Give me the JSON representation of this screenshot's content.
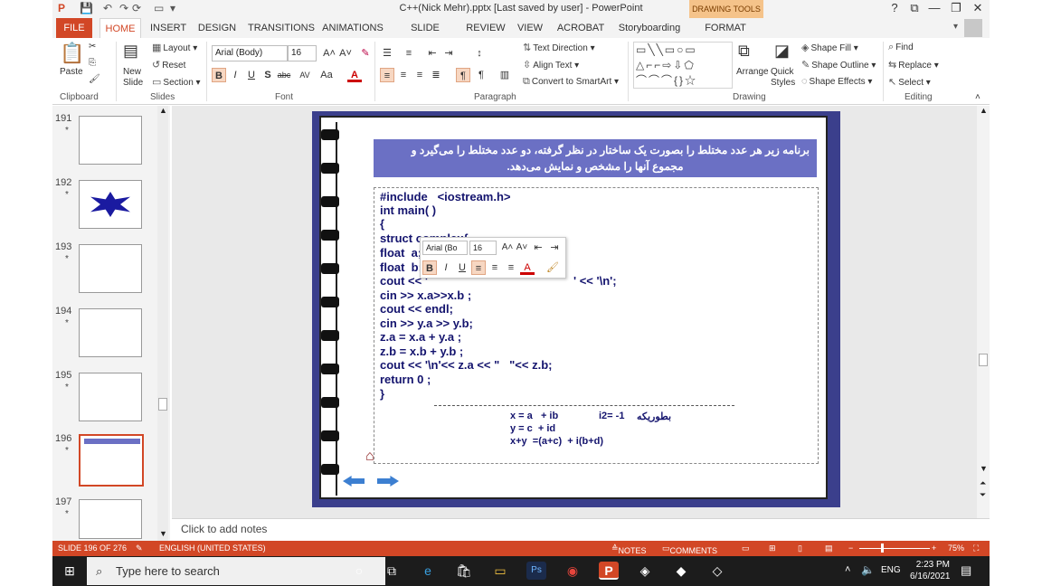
{
  "window": {
    "title": "C++(Nick Mehr).pptx [Last saved by user] - PowerPoint",
    "contextual_label": "DRAWING TOOLS",
    "help": "?",
    "restore": "⧉",
    "minimize": "—",
    "maximize": "❐",
    "close": "✕"
  },
  "qat": {
    "save": "💾",
    "undo": "↶",
    "redo": "↷",
    "refresh": "⟳",
    "customize": "▾"
  },
  "tabs": [
    "FILE",
    "HOME",
    "INSERT",
    "DESIGN",
    "TRANSITIONS",
    "ANIMATIONS",
    "SLIDE SHOW",
    "REVIEW",
    "VIEW",
    "ACROBAT",
    "Storyboarding",
    "FORMAT"
  ],
  "ribbon": {
    "clipboard": {
      "paste": "Paste",
      "label": "Clipboard"
    },
    "slides": {
      "new_slide": "New Slide",
      "layout": "Layout",
      "reset": "Reset",
      "section": "Section",
      "label": "Slides"
    },
    "font": {
      "name": "Arial (Body)",
      "size": "16",
      "label": "Font",
      "bold": "B",
      "italic": "I",
      "underline": "U",
      "shadow": "S",
      "strike": "abc",
      "spacing": "AV",
      "case": "Aa",
      "color": "A"
    },
    "paragraph": {
      "text_direction": "Text Direction",
      "align_text": "Align Text",
      "convert": "Convert to SmartArt",
      "label": "Paragraph"
    },
    "drawing": {
      "arrange": "Arrange",
      "quick_styles": "Quick Styles",
      "shape_fill": "Shape Fill",
      "shape_outline": "Shape Outline",
      "shape_effects": "Shape Effects",
      "label": "Drawing"
    },
    "editing": {
      "find": "Find",
      "replace": "Replace",
      "select": "Select",
      "label": "Editing"
    }
  },
  "thumbnails": [
    {
      "num": "191",
      "star": "*"
    },
    {
      "num": "192",
      "star": "*"
    },
    {
      "num": "193",
      "star": "*"
    },
    {
      "num": "194",
      "star": "*"
    },
    {
      "num": "195",
      "star": "*"
    },
    {
      "num": "196",
      "star": "*",
      "selected": true
    },
    {
      "num": "197",
      "star": "*"
    }
  ],
  "slide": {
    "banner_line1": "برنامه زیر هر عدد مختلط را بصورت یک ساختار در نظر گرفته، دو عدد مختلط را می‌گیرد و",
    "banner_line2": "مجموع آنها را مشخص و نمایش می‌دهد.",
    "code": [
      "#include   <iostream.h>",
      "int main( )",
      "{",
      "struct complex{",
      "float  a;",
      "float  b; }",
      "cout << '",
      "cin >> x.a>>x.b ;",
      "cout << endl;",
      "cin >> y.a >> y.b;",
      "z.a = x.a + y.a ;",
      "z.b = x.b + y.b ;",
      "cout << '\\n'<< z.a << \"   \"<< z.b;",
      "return 0 ;",
      "}"
    ],
    "code_tail": "' << '\\n';",
    "equations": {
      "eq1": "x = a   + ib",
      "eq1b": "i2= -1",
      "eq1c": "بطوریکه",
      "eq2": "y = c  + id",
      "eq3": "x+y  =(a+c)  + i(b+d)"
    }
  },
  "mini_toolbar": {
    "font": "Arial (Bo",
    "size": "16",
    "bold": "B",
    "italic": "I",
    "underline": "U"
  },
  "notes": {
    "placeholder": "Click to add notes"
  },
  "status": {
    "slide": "SLIDE 196 OF 276",
    "language": "ENGLISH (UNITED STATES)",
    "notes": "NOTES",
    "comments": "COMMENTS",
    "zoom": "75%"
  },
  "taskbar": {
    "search": "Type here to search",
    "lang": "ENG",
    "time": "2:23 PM",
    "date": "6/16/2021"
  },
  "colors": {
    "accent": "#d24726",
    "slide_frame": "#3b3f8c",
    "banner": "#6b70c4",
    "code_text": "#14146e"
  }
}
